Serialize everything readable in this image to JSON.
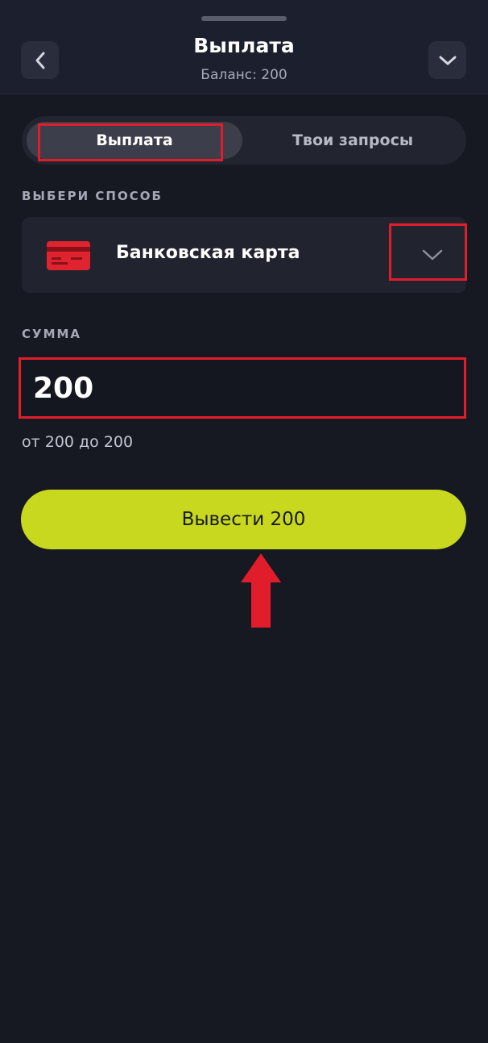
{
  "header": {
    "title": "Выплата",
    "balance": "Баланс: 200",
    "back_icon": "chevron-left-icon",
    "menu_icon": "chevron-down-icon"
  },
  "tabs": [
    {
      "label": "Выплата",
      "active": true
    },
    {
      "label": "Твои запросы",
      "active": false
    }
  ],
  "method": {
    "section_label": "ВЫБЕРИ СПОСОБ",
    "selected": "Банковская карта",
    "icon": "credit-card-icon",
    "dropdown_icon": "chevron-down-icon"
  },
  "amount": {
    "section_label": "СУММА",
    "value": "200",
    "range_hint": "от 200 до 200"
  },
  "submit": {
    "label": "Вывести 200"
  },
  "colors": {
    "background": "#161822",
    "accent": "#c8d81e",
    "highlight": "#e21d2b",
    "card_icon": "#e0242f"
  }
}
